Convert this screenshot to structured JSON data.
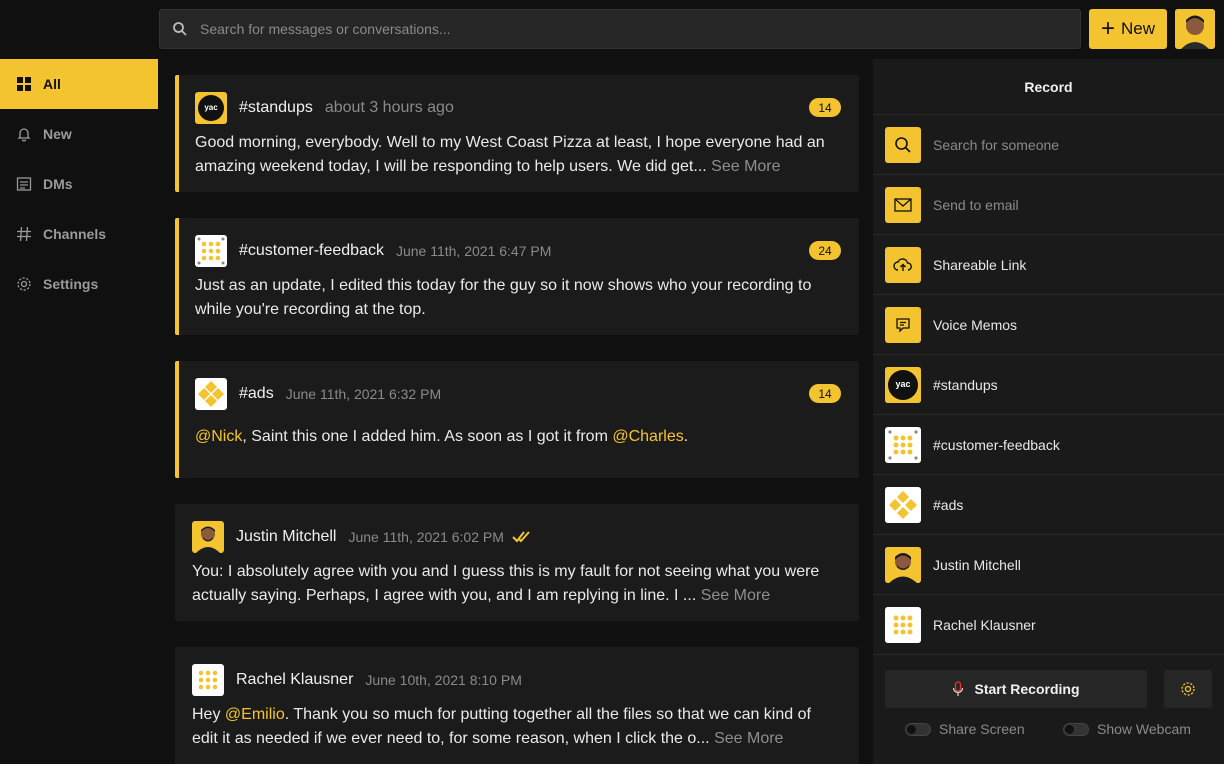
{
  "search": {
    "placeholder": "Search for messages or conversations..."
  },
  "header": {
    "new_label": "New"
  },
  "sidebar": {
    "items": [
      {
        "label": "All",
        "icon": "grid-icon",
        "active": true
      },
      {
        "label": "New",
        "icon": "bell-icon"
      },
      {
        "label": "DMs",
        "icon": "message-icon"
      },
      {
        "label": "Channels",
        "icon": "hash-icon"
      },
      {
        "label": "Settings",
        "icon": "gear-icon"
      }
    ]
  },
  "feed": {
    "cards": [
      {
        "name": "#standups",
        "time": "about 3 hours ago",
        "badge": "14",
        "text": "Good morning, everybody. Well to my West Coast Pizza at least, I hope everyone had an amazing weekend today, I will be responding to help users. We did get...",
        "see_more": "See More"
      },
      {
        "name": "#customer-feedback",
        "time": "June 11th, 2021 6:47 PM",
        "badge": "24",
        "text": "Just as an update, I edited this today for the guy so it now shows who your recording to while you're recording at the top."
      },
      {
        "name": "#ads",
        "time": "June 11th, 2021 6:32 PM",
        "badge": "14",
        "mention1": "@Nick",
        "text_mid": ", Saint this one I added him. As soon as I got it from ",
        "mention2": "@Charles",
        "text_end": "."
      },
      {
        "name": "Justin Mitchell",
        "time": "June 11th, 2021 6:02 PM",
        "text": "You: I absolutely agree with you and I guess this is my fault for not seeing what you were actually saying. Perhaps, I agree with you, and I am replying in line. I ...",
        "see_more": "See More"
      },
      {
        "name": "Rachel Klausner",
        "time": "June 10th, 2021 8:10 PM",
        "text_pre": "Hey ",
        "mention1": "@Emilio",
        "text": ". Thank you so much for putting together all the files so that we can kind of edit it as needed if we ever need to, for some reason, when I click the o...",
        "see_more": "See More"
      }
    ]
  },
  "panel": {
    "title": "Record",
    "rows": [
      {
        "label": "Search for someone",
        "icon": "search-icon",
        "muted": true
      },
      {
        "label": "Send to email",
        "icon": "mail-icon",
        "muted": true
      },
      {
        "label": "Shareable Link",
        "icon": "cloud-upload-icon"
      },
      {
        "label": "Voice Memos",
        "icon": "memo-icon"
      },
      {
        "label": "#standups"
      },
      {
        "label": "#customer-feedback"
      },
      {
        "label": "#ads"
      },
      {
        "label": "Justin Mitchell"
      },
      {
        "label": "Rachel Klausner"
      }
    ],
    "start_label": "Start Recording",
    "share_screen_label": "Share Screen",
    "show_webcam_label": "Show Webcam"
  },
  "colors": {
    "accent": "#f4c430",
    "background": "#101010",
    "card": "#1b1b1b"
  }
}
